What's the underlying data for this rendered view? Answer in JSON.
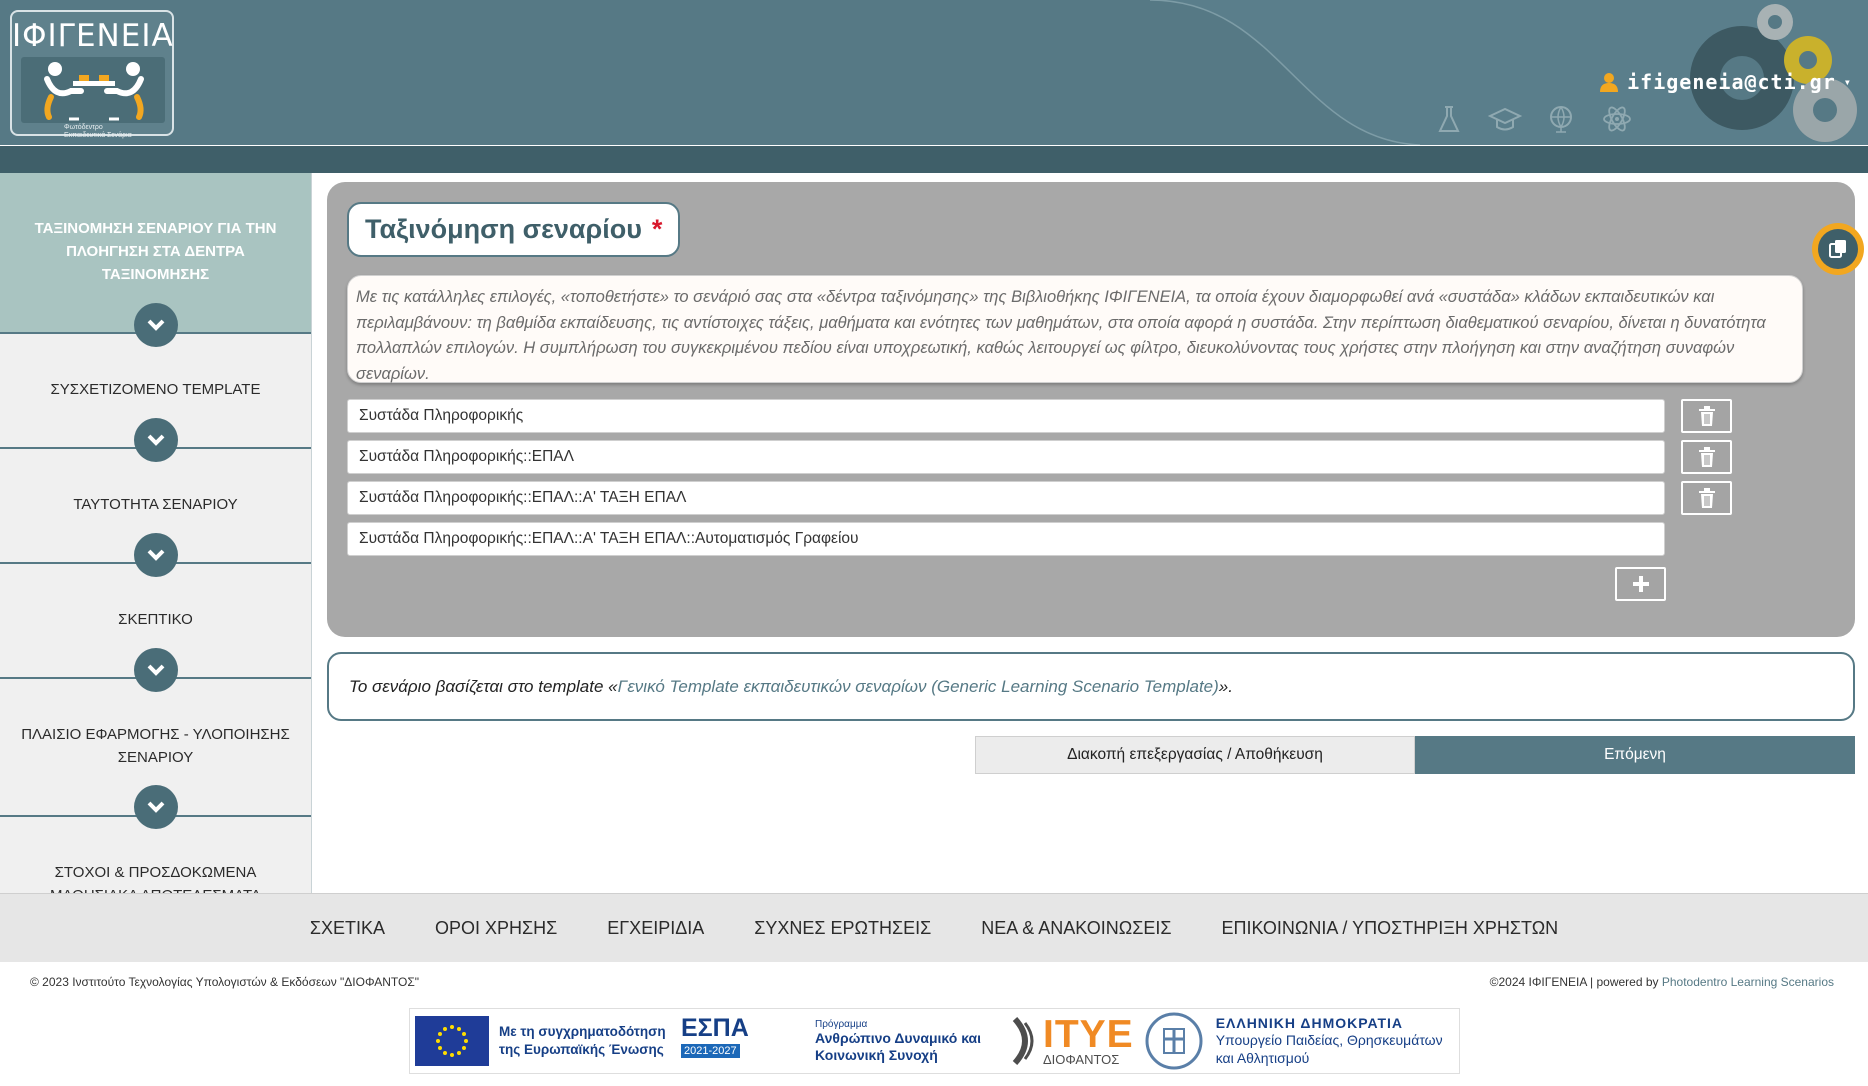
{
  "header": {
    "logo_text": "ΙΦΙΓΕΝΕΙΑ",
    "logo_sub_line1": "Φωτόδεντρο",
    "logo_sub_line2": "Εκπαιδευτικά Σενάρια",
    "user": "ifigeneia@cti.gr",
    "subject_icons": [
      "flask-icon",
      "graduation-cap-icon",
      "globe-icon",
      "atom-icon"
    ]
  },
  "sidebar": {
    "steps": [
      {
        "label": "ΤΑΞΙΝΟΜΗΣΗ ΣΕΝΑΡΙΟΥ ΓΙΑ ΤΗΝ ΠΛΟΗΓΗΣΗ ΣΤΑ ΔΕΝΤΡΑ ΤΑΞΙΝΟΜΗΣΗΣ",
        "active": true
      },
      {
        "label": "ΣΥΣΧΕΤΙΖΟΜΕΝΟ TEMPLATE",
        "active": false
      },
      {
        "label": "ΤΑΥΤΟΤΗΤΑ ΣΕΝΑΡΙΟΥ",
        "active": false
      },
      {
        "label": "ΣΚΕΠΤΙΚΟ",
        "active": false
      },
      {
        "label": "ΠΛΑΙΣΙΟ ΕΦΑΡΜΟΓΗΣ - ΥΛΟΠΟΙΗΣΗΣ ΣΕΝΑΡΙΟΥ",
        "active": false
      },
      {
        "label": "ΣΤΟΧΟΙ & ΠΡΟΣΔΟΚΩΜΕΝΑ ΜΑΘΗΣΙΑΚΑ ΑΠΟΤΕΛΕΣΜΑΤΑ",
        "active": false
      }
    ]
  },
  "main": {
    "title": "Ταξινόμηση σεναρίου",
    "required_mark": "*",
    "description": "Με τις κατάλληλες επιλογές, «τοποθετήστε» το σενάριό σας στα «δέντρα ταξινόμησης» της Βιβλιοθήκης ΙΦΙΓΕΝΕΙΑ, τα οποία έχουν διαμορφωθεί ανά «συστάδα» κλάδων εκπαιδευτικών και περιλαμβάνουν: τη βαθμίδα εκπαίδευσης, τις αντίστοιχες τάξεις, μαθήματα και ενότητες των μαθημάτων, στα οποία αφορά η συστάδα. Στην περίπτωση διαθεματικού σεναρίου, δίνεται η δυνατότητα πολλαπλών επιλογών. Η συμπλήρωση του συγκεκριμένου πεδίου είναι υποχρεωτική, καθώς λειτουργεί ως φίλτρο, διευκολύνοντας τους χρήστες στην πλοήγηση και στην αναζήτηση συναφών σεναρίων.",
    "taxonomy_fields": [
      {
        "value": "Συστάδα Πληροφορικής",
        "deletable": true
      },
      {
        "value": "Συστάδα Πληροφορικής::ΕΠΑΛ",
        "deletable": true
      },
      {
        "value": "Συστάδα Πληροφορικής::ΕΠΑΛ::Α' ΤΑΞΗ ΕΠΑΛ",
        "deletable": true
      },
      {
        "value": "Συστάδα Πληροφορικής::ΕΠΑΛ::Α' ΤΑΞΗ ΕΠΑΛ::Αυτοματισμός Γραφείου",
        "deletable": false
      }
    ],
    "note_prefix": "Το σενάριο βασίζεται στο template «",
    "note_link": "Γενικό Template εκπαιδευτικών σεναρίων (Generic Learning Scenario Template)",
    "note_suffix": "».",
    "btn_stop": "Διακοπή επεξεργασίας / Αποθήκευση",
    "btn_next": "Επόμενη"
  },
  "footer": {
    "nav": [
      "ΣΧΕΤΙΚΑ",
      "ΟΡΟΙ ΧΡΗΣΗΣ",
      "ΕΓΧΕΙΡΙΔΙΑ",
      "ΣΥΧΝΕΣ ΕΡΩΤΗΣΕΙΣ",
      "ΝΕΑ & ΑΝΑΚΟΙΝΩΣΕΙΣ",
      "ΕΠΙΚΟΙΝΩΝΙΑ / ΥΠΟΣΤΗΡΙΞΗ ΧΡΗΣΤΩΝ"
    ],
    "copyright_left": "© 2023 Ινστιτούτο Τεχνολογίας Υπολογιστών & Εκδόσεων \"ΔΙΟΦΑΝΤΟΣ\"",
    "copyright_right_prefix": "©2024 ΙΦΙΓΕΝΕΙΑ | powered by ",
    "copyright_right_link": "Photodentro Learning Scenarios",
    "funding": {
      "eu_line1": "Με τη συγχρηματοδότηση",
      "eu_line2": "της Ευρωπαϊκής Ένωσης",
      "espa": "ΕΣΠΑ",
      "espa_years": "2021-2027",
      "program_label": "Πρόγραμμα",
      "program_line1": "Ανθρώπινο Δυναμικό και",
      "program_line2": "Κοινωνική Συνοχή",
      "itye": "ΙΤΥΕ",
      "itye_sub": "ΔΙΟΦΑΝΤΟΣ",
      "gr_title": "ΕΛΛΗΝΙΚΗ ΔΗΜΟΚΡΑΤΙΑ",
      "gr_line1": "Υπουργείο Παιδείας, Θρησκευμάτων",
      "gr_line2": "και Αθλητισμού"
    }
  },
  "colors": {
    "primary": "#567985",
    "active_step": "#a9c4c1",
    "required": "#d8182c",
    "accent": "#f2a720"
  }
}
